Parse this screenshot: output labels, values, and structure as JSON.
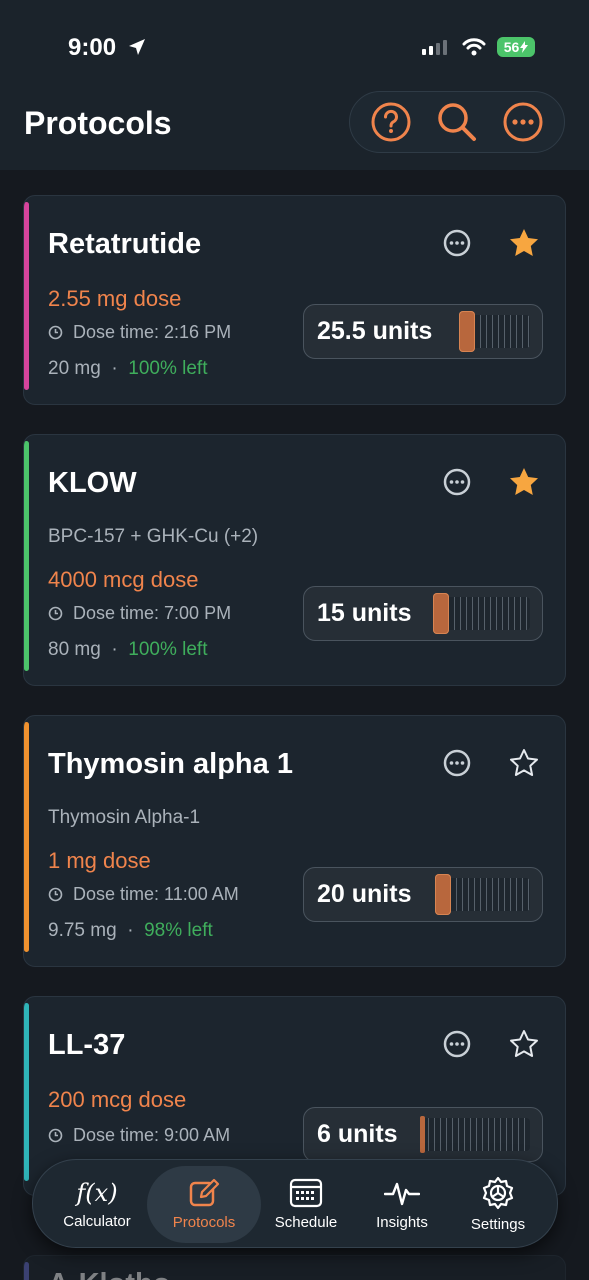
{
  "status_bar": {
    "time": "9:00",
    "battery": "56"
  },
  "header": {
    "title": "Protocols"
  },
  "protocols": [
    {
      "name": "Retatrutide",
      "subtitle": "",
      "dose": "2.55 mg dose",
      "dose_time": "Dose time: 2:16 PM",
      "amount": "20 mg",
      "separator": "·",
      "left": "100% left",
      "units": "25.5 units",
      "syringe_fill_fraction": 0.255,
      "starred": true,
      "accent_color": "#d6449c"
    },
    {
      "name": "KLOW",
      "subtitle": "BPC-157 + GHK-Cu (+2)",
      "dose": "4000 mcg dose",
      "dose_time": "Dose time: 7:00 PM",
      "amount": "80 mg",
      "separator": "·",
      "left": "100% left",
      "units": "15 units",
      "syringe_fill_fraction": 0.15,
      "starred": true,
      "accent_color": "#4cc46a"
    },
    {
      "name": "Thymosin alpha 1",
      "subtitle": "Thymosin Alpha-1",
      "dose": "1 mg dose",
      "dose_time": "Dose time: 11:00 AM",
      "amount": "9.75 mg",
      "separator": "·",
      "left": "98% left",
      "units": "20 units",
      "syringe_fill_fraction": 0.2,
      "starred": false,
      "accent_color": "#f0922f"
    },
    {
      "name": "LL-37",
      "subtitle": "",
      "dose": "200 mcg dose",
      "dose_time": "Dose time: 9:00 AM",
      "amount": "",
      "separator": "",
      "left": "",
      "units": "6 units",
      "syringe_fill_fraction": 0.06,
      "starred": false,
      "accent_color": "#2fb4b8"
    }
  ],
  "peek": {
    "name": "A-Klotho"
  },
  "tabbar": {
    "calculator_glyph": "f(x)",
    "calculator": "Calculator",
    "protocols": "Protocols",
    "schedule": "Schedule",
    "insights": "Insights",
    "settings": "Settings",
    "active": "Protocols"
  },
  "colors": {
    "accent": "#f0844c",
    "background": "#15191f",
    "card": "#1c252e",
    "positive": "#3fae5c"
  },
  "icons": {
    "header": [
      "help-icon",
      "search-icon",
      "more-icon"
    ],
    "card": [
      "more-icon",
      "star-icon",
      "clock-icon"
    ],
    "tabs": [
      "function-icon",
      "edit-icon",
      "calendar-icon",
      "pulse-icon",
      "gear-icon"
    ]
  }
}
